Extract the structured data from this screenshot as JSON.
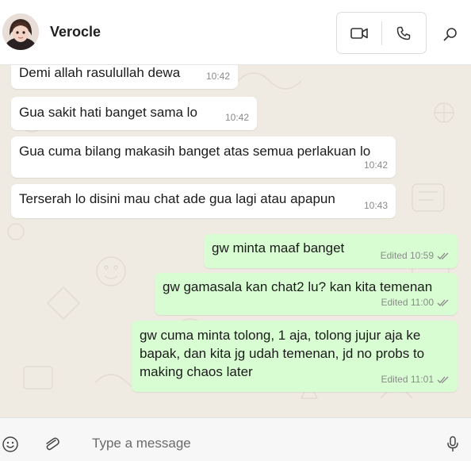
{
  "header": {
    "contact_name": "Verocle",
    "video_call_icon": "video-camera-icon",
    "voice_call_icon": "phone-icon",
    "search_icon": "search-icon"
  },
  "messages": [
    {
      "direction": "in",
      "text": "Demi allah rasulullah dewa",
      "time": "10:42"
    },
    {
      "direction": "in",
      "text": "Gua sakit hati banget sama lo",
      "time": "10:42"
    },
    {
      "direction": "in",
      "text": "Gua cuma bilang makasih banget atas semua perlakuan lo",
      "time": "10:42"
    },
    {
      "direction": "in",
      "text": "Terserah lo disini mau chat ade gua lagi atau apapun",
      "time": "10:43"
    },
    {
      "direction": "out",
      "text": "gw minta maaf banget",
      "time": "Edited 10:59"
    },
    {
      "direction": "out",
      "text": "gw gamasala kan chat2 lu? kan kita temenan",
      "time": "Edited 11:00"
    },
    {
      "direction": "out",
      "lines": [
        "gw cuma minta tolong, 1 aja, tolong jujur aja ke",
        "bapak, dan kita jg udah temenan, jd no probs to",
        "making chaos later"
      ],
      "time": "Edited 11:01"
    }
  ],
  "composer": {
    "placeholder": "Type a message",
    "emoji_icon": "emoji-icon",
    "attach_icon": "paperclip-icon",
    "mic_icon": "microphone-icon"
  },
  "colors": {
    "outgoing_bubble": "#d9fdd3",
    "incoming_bubble": "#ffffff",
    "chat_background": "#efeae2"
  }
}
